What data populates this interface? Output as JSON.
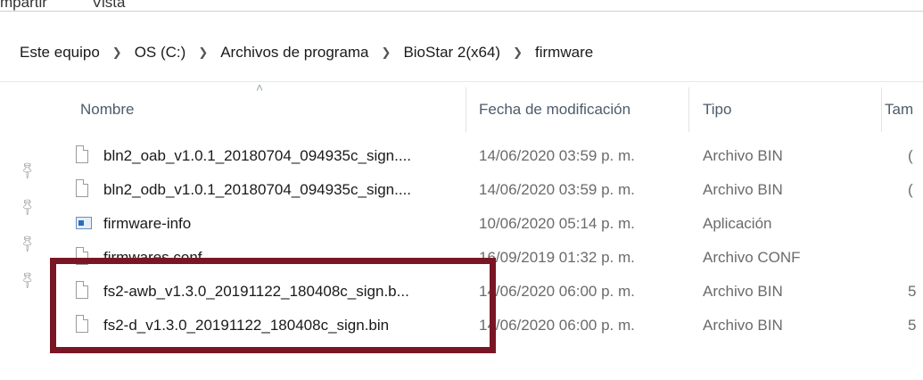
{
  "ribbon": {
    "tab1": "mpartir",
    "tab2": "Vista"
  },
  "breadcrumb": [
    "Este equipo",
    "OS (C:)",
    "Archivos de programa",
    "BioStar 2(x64)",
    "firmware"
  ],
  "columns": {
    "name": "Nombre",
    "date": "Fecha de modificación",
    "type": "Tipo",
    "size": "Tam"
  },
  "files": [
    {
      "name": "bln2_oab_v1.0.1_20180704_094935c_sign....",
      "date": "14/06/2020 03:59 p. m.",
      "type": "Archivo BIN",
      "size": "(",
      "icon": "file-icon"
    },
    {
      "name": "bln2_odb_v1.0.1_20180704_094935c_sign....",
      "date": "14/06/2020 03:59 p. m.",
      "type": "Archivo BIN",
      "size": "(",
      "icon": "file-icon"
    },
    {
      "name": "firmware-info",
      "date": "10/06/2020 05:14 p. m.",
      "type": "Aplicación",
      "size": "",
      "icon": "application-icon"
    },
    {
      "name": "firmwares.conf",
      "date": "16/09/2019 01:32 p. m.",
      "type": "Archivo CONF",
      "size": "",
      "icon": "file-icon"
    },
    {
      "name": "fs2-awb_v1.3.0_20191122_180408c_sign.b...",
      "date": "14/06/2020 06:00 p. m.",
      "type": "Archivo BIN",
      "size": "5",
      "icon": "file-icon"
    },
    {
      "name": "fs2-d_v1.3.0_20191122_180408c_sign.bin",
      "date": "14/06/2020 06:00 p. m.",
      "type": "Archivo BIN",
      "size": "5",
      "icon": "file-icon"
    }
  ],
  "colors": {
    "highlight": "#7a1624"
  }
}
